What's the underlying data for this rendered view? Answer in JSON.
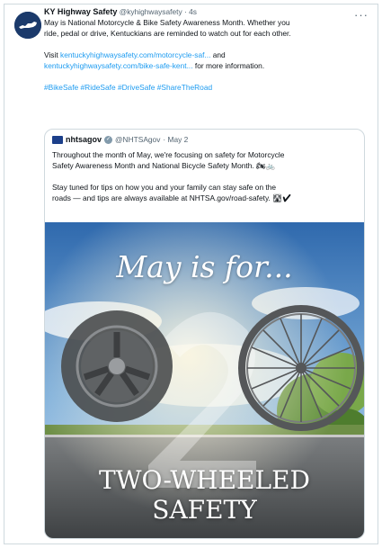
{
  "tweet": {
    "author_name": "KY Highway Safety",
    "handle": "@kyhighwaysafety",
    "time": "· 4s",
    "more_label": "···",
    "line1": "May is National Motorcycle & Bike Safety Awareness Month. Whether you",
    "line2": "ride, pedal or drive, Kentuckians are reminded to watch out for each other.",
    "visit_prefix": "Visit ",
    "link1": "kentuckyhighwaysafety.com/motorcycle-saf...",
    "and_text": " and",
    "link2": "kentuckyhighwaysafety.com/bike-safe-kent...",
    "suffix": " for more information.",
    "hashtags": "#BikeSafe #RideSafe #DriveSafe #ShareTheRoad"
  },
  "quote": {
    "author_name": "nhtsagov",
    "handle": "@NHTSAgov",
    "time": "· May 2",
    "line1": "Throughout the month of May, we're focusing on safety for Motorcycle",
    "line2": "Safety Awareness Month and National Bicycle Safety Month. 🏍🚲",
    "line3": "Stay tuned for tips on how you and your family can stay safe on the",
    "line4": "roads — and tips are always available at NHTSA.gov/road-safety. 🛣✔",
    "image_headline": "May is for...",
    "image_line1": "TWO-WHEELED",
    "image_line2": "SAFETY"
  },
  "icons": [
    "kentucky-state-icon",
    "verified-badge-icon",
    "nhtsa-logo-icon",
    "motorcycle-wheel-icon",
    "bicycle-wheel-icon",
    "number-two-icon"
  ],
  "colors": {
    "link": "#1d9bf0",
    "muted": "#536471",
    "avatar_bg": "#1b3a6b",
    "sky": "#3f7fc4",
    "road": "#5d5f60"
  }
}
